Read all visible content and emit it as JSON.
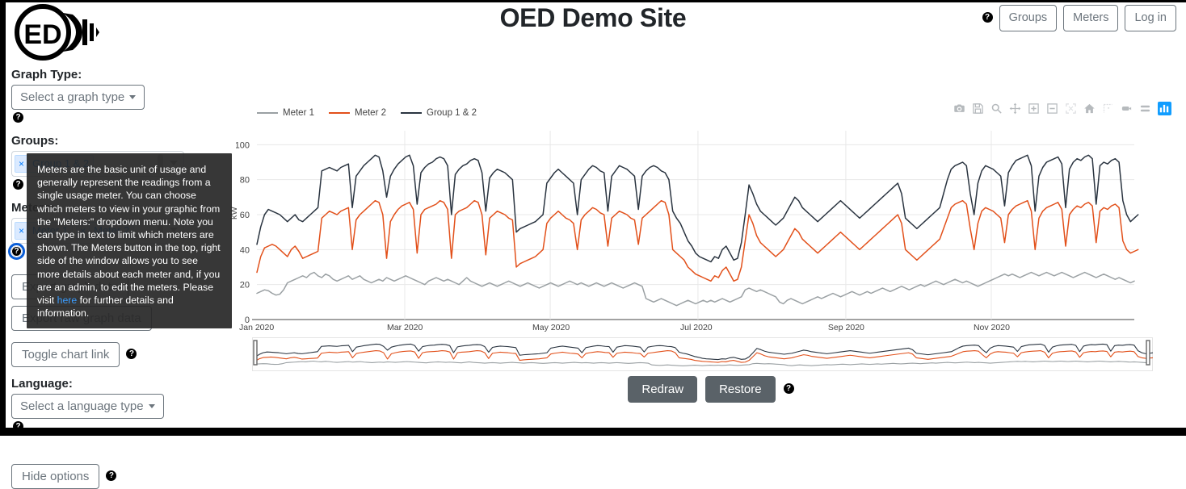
{
  "header": {
    "title": "OED Demo Site",
    "help_icon": "help-circle-icon",
    "buttons": [
      {
        "label": "Groups"
      },
      {
        "label": "Meters"
      },
      {
        "label": "Log in"
      }
    ]
  },
  "logo": {
    "text": "ED",
    "alt": "oed-logo"
  },
  "sidebar": {
    "graph_type": {
      "label": "Graph Type:",
      "placeholder": "Select a graph type"
    },
    "groups": {
      "label": "Groups:",
      "tags": [
        {
          "label": "Group 1 & 2",
          "remove": "×"
        }
      ]
    },
    "meters": {
      "label": "Meters:",
      "tags": [
        {
          "label": "Meter 1",
          "remove": "×"
        },
        {
          "label": "Meter 2",
          "remove": "×"
        }
      ]
    },
    "export_graph_label": "Export graph data",
    "export_raw_label": "Export raw graph data",
    "toggle_chart_link_label": "Toggle chart link",
    "language": {
      "label": "Language:",
      "placeholder": "Select a language type"
    },
    "hide_options_label": "Hide options"
  },
  "tooltip": {
    "text_before_link": "Meters are the basic unit of usage and generally represent the readings from a single usage meter. You can choose which meters to view in your graphic from the \"Meters:\" dropdown menu. Note you can type in text to limit which meters are shown. The Meters button in the top, right side of the window allows you to see more details about each meter and, if you are an admin, to edit the meters. Please visit ",
    "link_text": "here",
    "text_after_link": " for further details and information."
  },
  "chart_controls": {
    "redraw_label": "Redraw",
    "restore_label": "Restore",
    "modebar": [
      "camera-icon",
      "disk-save-icon",
      "zoom-magnifier-icon",
      "pan-move-icon",
      "zoom-in-icon",
      "zoom-out-icon",
      "autoscale-icon",
      "reset-home-icon",
      "toggle-spikelines-icon",
      "hover-compare-icon",
      "hover-closest-icon",
      "plotly-logo-icon"
    ]
  },
  "chart_data": {
    "type": "line",
    "title": "",
    "xlabel": "",
    "ylabel": "kW",
    "ylim": [
      0,
      108
    ],
    "yticks": [
      0,
      20,
      40,
      60,
      80,
      100
    ],
    "xticks": [
      "Jan 2020",
      "Mar 2020",
      "May 2020",
      "Jul 2020",
      "Sep 2020",
      "Nov 2020"
    ],
    "xlim": [
      "Jan 2020",
      "Dec 2020"
    ],
    "grid": true,
    "legend_position": "top-left",
    "has_rangeslider": true,
    "colors": {
      "meter1": "#9aa0a3",
      "meter2": "#e2501a",
      "group": "#2a3440"
    },
    "series": [
      {
        "name": "Meter 1",
        "color": "#9aa0a3",
        "values": [
          15,
          16,
          17,
          16.5,
          15,
          14,
          14.5,
          17,
          21,
          22,
          23,
          24,
          25,
          24,
          26,
          27,
          25,
          24,
          26,
          25,
          23,
          22,
          23,
          24,
          25,
          23,
          24,
          25,
          23,
          22,
          21,
          22,
          23,
          22,
          24,
          23,
          22,
          23,
          24,
          25,
          24,
          23,
          22,
          21,
          20,
          22,
          23,
          24,
          23,
          22,
          23,
          22,
          21,
          20,
          22,
          24,
          22,
          21,
          20,
          19,
          20,
          21,
          20,
          19,
          20,
          21,
          22,
          21,
          20,
          19,
          20,
          21,
          20,
          19,
          18,
          19,
          20,
          21,
          20,
          19,
          20,
          21,
          22,
          21,
          20,
          21,
          20,
          19,
          20,
          21,
          20,
          19,
          20,
          21,
          20,
          19,
          18,
          19,
          20,
          21,
          20,
          19,
          12,
          11,
          10,
          11,
          12,
          11,
          10,
          9,
          8,
          9,
          10,
          11,
          10,
          9,
          10,
          11,
          10,
          11,
          10,
          11,
          12,
          11,
          10,
          11,
          12,
          13,
          17,
          18,
          17,
          16,
          17,
          16,
          15,
          14,
          13,
          10,
          9,
          11,
          12,
          11,
          10,
          9,
          10,
          11,
          12,
          13,
          12,
          13,
          14,
          15,
          14,
          13,
          14,
          15,
          16,
          15,
          14,
          15,
          16,
          15,
          16,
          17,
          18,
          17,
          16,
          17,
          18,
          19,
          18,
          17,
          18,
          19,
          20,
          19,
          20,
          21,
          22,
          21,
          20,
          21,
          22,
          23,
          22,
          21,
          22,
          21,
          20,
          19,
          20,
          21,
          22,
          23,
          24,
          25,
          26,
          25,
          26,
          25,
          24,
          25,
          26,
          27,
          26,
          25,
          26,
          27,
          26,
          25,
          26,
          27,
          26,
          25,
          24,
          25,
          26,
          27,
          26,
          25,
          24,
          25,
          26,
          25,
          24,
          23,
          24,
          23,
          22,
          21,
          22
        ]
      },
      {
        "name": "Meter 2",
        "color": "#e2501a",
        "values": [
          27,
          36,
          41,
          42,
          43,
          42,
          40,
          38,
          36,
          40,
          42,
          39,
          35,
          36,
          37,
          38,
          39,
          58,
          60,
          62,
          61,
          60,
          62,
          63,
          64,
          40,
          57,
          60,
          62,
          64,
          66,
          68,
          67,
          60,
          35,
          56,
          60,
          63,
          65,
          66,
          67,
          63,
          38,
          60,
          63,
          64,
          65,
          66,
          68,
          67,
          63,
          35,
          60,
          62,
          63,
          64,
          66,
          68,
          67,
          60,
          37,
          58,
          60,
          62,
          61,
          60,
          58,
          57,
          30,
          32,
          33,
          34,
          35,
          36,
          38,
          40,
          55,
          58,
          60,
          62,
          60,
          58,
          57,
          55,
          40,
          57,
          60,
          62,
          64,
          63,
          61,
          60,
          42,
          58,
          60,
          62,
          61,
          60,
          58,
          57,
          43,
          58,
          60,
          62,
          64,
          66,
          68,
          67,
          60,
          40,
          38,
          36,
          34,
          30,
          28,
          26,
          25,
          24,
          23,
          22,
          25,
          24,
          28,
          30,
          26,
          22,
          23,
          30,
          45,
          60,
          55,
          48,
          44,
          42,
          40,
          38,
          36,
          38,
          40,
          44,
          48,
          52,
          50,
          46,
          44,
          42,
          40,
          38,
          40,
          42,
          44,
          46,
          48,
          50,
          48,
          46,
          44,
          42,
          40,
          42,
          44,
          46,
          48,
          50,
          52,
          54,
          56,
          58,
          60,
          55,
          40,
          38,
          36,
          34,
          36,
          38,
          40,
          42,
          44,
          46,
          52,
          58,
          64,
          66,
          67,
          68,
          66,
          52,
          40,
          55,
          62,
          64,
          63,
          62,
          60,
          58,
          44,
          60,
          63,
          65,
          66,
          67,
          68,
          62,
          40,
          58,
          62,
          64,
          65,
          66,
          67,
          63,
          42,
          60,
          63,
          65,
          64,
          66,
          67,
          65,
          44,
          62,
          64,
          63,
          65,
          66,
          64,
          45,
          40,
          38,
          39,
          40
        ]
      },
      {
        "name": "Group 1 & 2",
        "color": "#2a3440",
        "values": [
          43,
          53,
          60,
          63,
          62,
          61,
          60,
          58,
          56,
          58,
          60,
          57,
          56,
          58,
          60,
          62,
          64,
          85,
          86,
          87,
          86,
          85,
          87,
          88,
          89,
          64,
          82,
          85,
          88,
          90,
          92,
          94,
          93,
          85,
          70,
          82,
          86,
          89,
          91,
          93,
          94,
          88,
          66,
          84,
          87,
          89,
          90,
          92,
          93,
          92,
          88,
          60,
          83,
          86,
          88,
          89,
          91,
          92,
          91,
          84,
          62,
          81,
          84,
          86,
          85,
          84,
          82,
          80,
          50,
          52,
          53,
          54,
          55,
          56,
          58,
          60,
          78,
          81,
          84,
          86,
          84,
          82,
          80,
          78,
          60,
          80,
          83,
          86,
          88,
          87,
          85,
          84,
          62,
          82,
          85,
          88,
          87,
          86,
          84,
          82,
          63,
          82,
          85,
          87,
          88,
          87,
          85,
          84,
          80,
          62,
          58,
          55,
          50,
          45,
          42,
          38,
          36,
          35,
          34,
          33,
          36,
          35,
          40,
          42,
          38,
          34,
          35,
          44,
          60,
          77,
          72,
          66,
          62,
          60,
          58,
          56,
          54,
          56,
          58,
          62,
          66,
          70,
          68,
          64,
          62,
          60,
          58,
          56,
          58,
          60,
          62,
          64,
          66,
          68,
          66,
          64,
          62,
          60,
          58,
          60,
          62,
          64,
          66,
          68,
          70,
          72,
          74,
          76,
          78,
          72,
          58,
          56,
          54,
          52,
          54,
          56,
          58,
          60,
          62,
          64,
          72,
          80,
          86,
          88,
          89,
          90,
          88,
          72,
          60,
          78,
          85,
          88,
          87,
          86,
          84,
          82,
          65,
          84,
          88,
          91,
          92,
          93,
          94,
          88,
          62,
          82,
          87,
          90,
          91,
          92,
          93,
          89,
          64,
          86,
          90,
          92,
          91,
          93,
          94,
          92,
          66,
          88,
          90,
          89,
          91,
          92,
          90,
          68,
          60,
          56,
          58,
          60
        ]
      }
    ]
  }
}
